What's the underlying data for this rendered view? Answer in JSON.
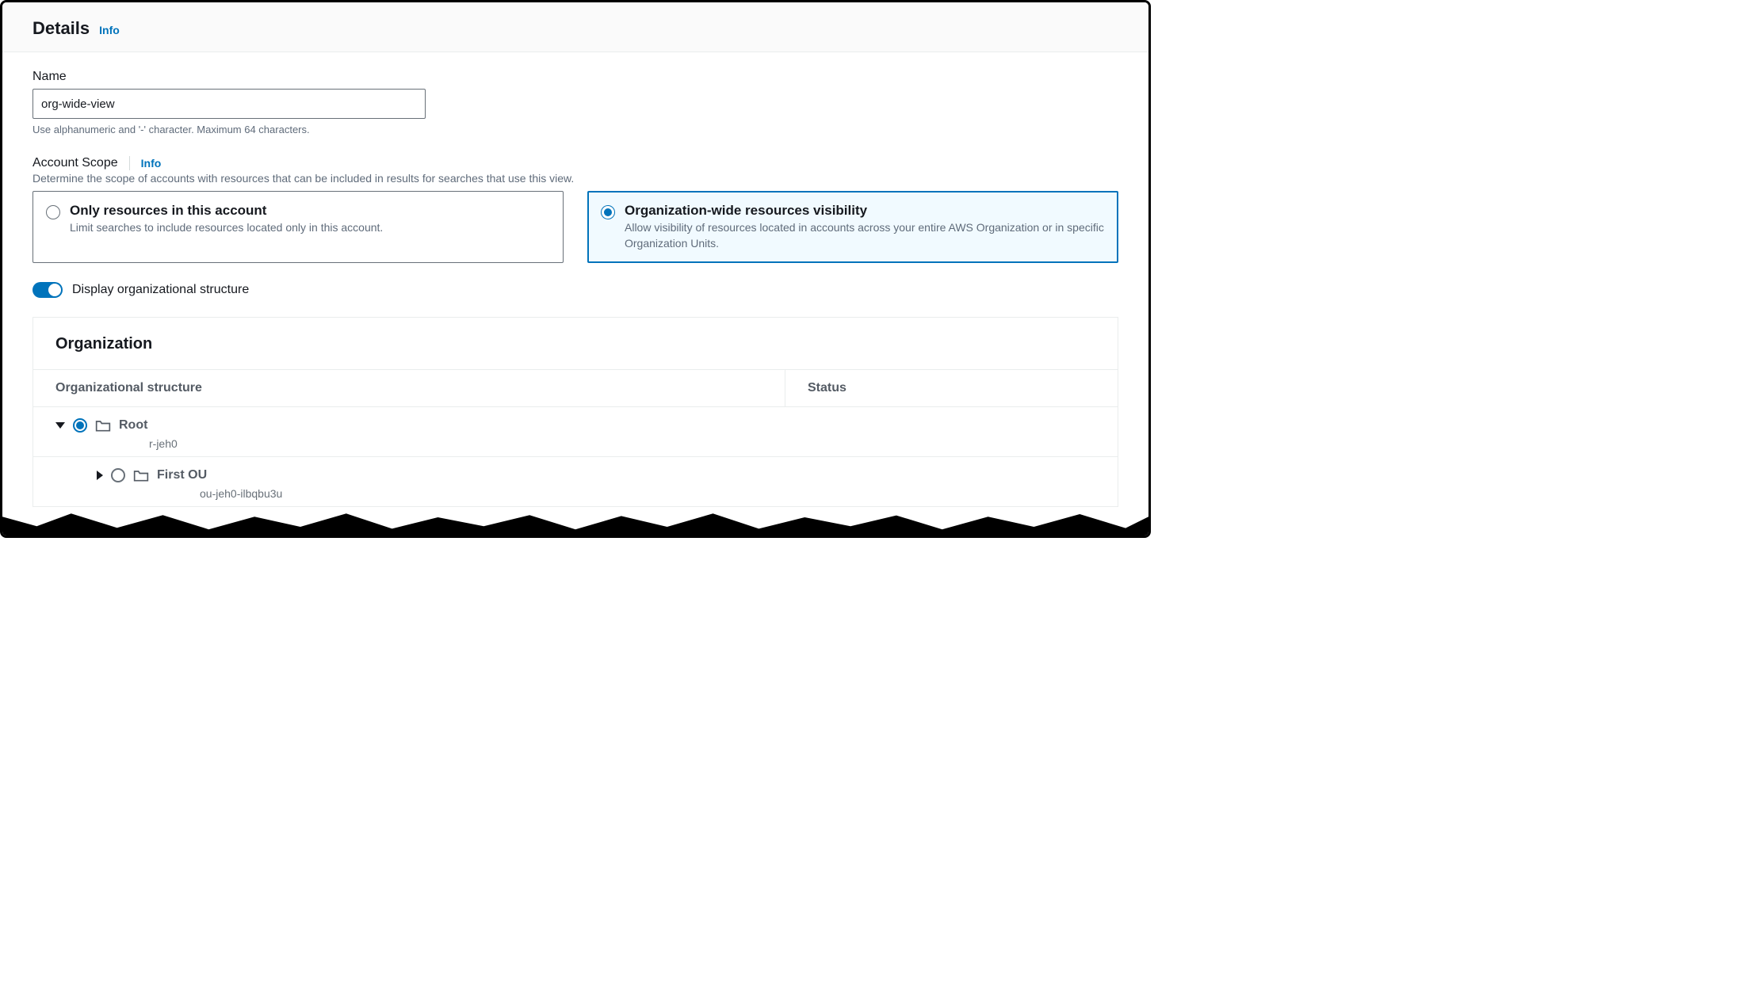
{
  "header": {
    "title": "Details",
    "info": "Info"
  },
  "name": {
    "label": "Name",
    "value": "org-wide-view",
    "hint": "Use alphanumeric and '-' character. Maximum 64 characters."
  },
  "scope": {
    "label": "Account Scope",
    "info": "Info",
    "desc": "Determine the scope of accounts with resources that can be included in results for searches that use this view.",
    "options": [
      {
        "title": "Only resources in this account",
        "desc": "Limit searches to include resources located only in this account.",
        "selected": false
      },
      {
        "title": "Organization-wide resources visibility",
        "desc": "Allow visibility of resources located in accounts across your entire AWS Organization or in specific Organization Units.",
        "selected": true
      }
    ]
  },
  "toggle": {
    "label": "Display organizational structure",
    "on": true
  },
  "org": {
    "title": "Organization",
    "col_structure": "Organizational structure",
    "col_status": "Status",
    "tree": [
      {
        "name": "Root",
        "id": "r-jeh0",
        "expanded": true,
        "selected": true
      },
      {
        "name": "First OU",
        "id": "ou-jeh0-ilbqbu3u",
        "expanded": false,
        "selected": false
      }
    ]
  }
}
